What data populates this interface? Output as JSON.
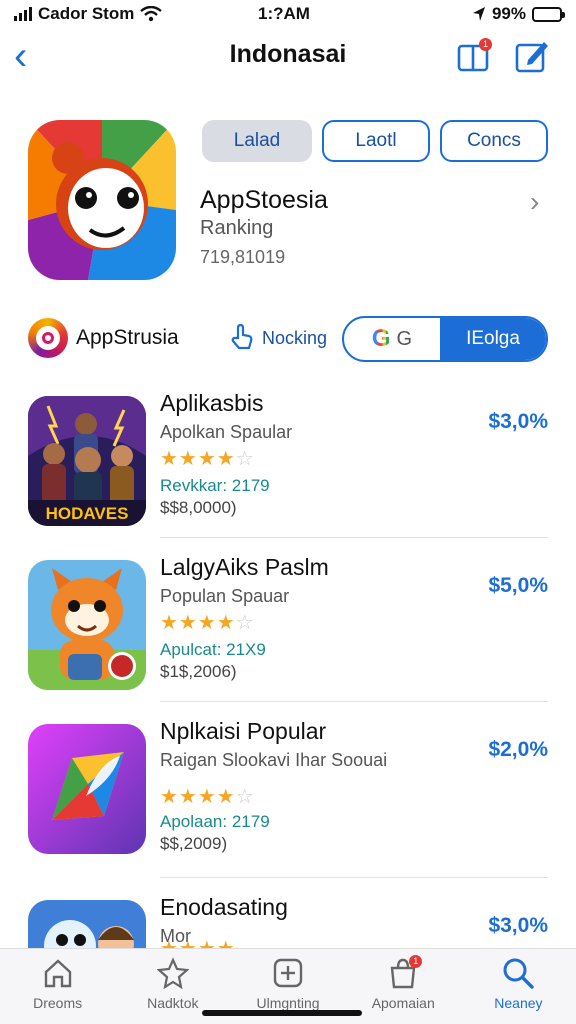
{
  "status": {
    "carrier": "Cador Stom",
    "time": "1:?AM",
    "battery": "99%"
  },
  "nav": {
    "title": "Indonasai",
    "share_badge": "1"
  },
  "header": {
    "segments": [
      {
        "label": "Lalad",
        "active": true
      },
      {
        "label": "Laotl",
        "active": false
      },
      {
        "label": "Concs",
        "active": false
      }
    ],
    "app_name": "AppStoesia",
    "app_subtitle": "Ranking",
    "app_number": "719,81019"
  },
  "filter": {
    "brand_label": "AppStrusia",
    "nocking_label": "Nocking",
    "toggle_left": "G",
    "toggle_right": "IEolga"
  },
  "apps": [
    {
      "name": "Aplikasbis",
      "subtitle": "Apolkan Spaular",
      "rating": 4,
      "meta": "Revkkar: 2179",
      "price": "$$8,0000)",
      "pct": "$3,0%",
      "thumb_text": "HODAVES"
    },
    {
      "name": "LalgyAiks Paslm",
      "subtitle": "Populan Spauar",
      "rating": 4,
      "meta": "Apulcat: 21X9",
      "price": "$1$,2006)",
      "pct": "$5,0%"
    },
    {
      "name": "Nplkaisi Popular",
      "subtitle": "Raigan Slookavi Ihar Soouai",
      "rating": 4,
      "meta": "Apolaan: 2179",
      "price": "$$,2009)",
      "pct": "$2,0%"
    },
    {
      "name": "Enodasating",
      "subtitle": "Mor",
      "rating": 4,
      "meta": "",
      "price": "",
      "pct": "$3,0%"
    }
  ],
  "tabs": [
    {
      "label": "Dreoms",
      "icon": "home-icon",
      "active": false
    },
    {
      "label": "Nadktok",
      "icon": "star-icon",
      "active": false
    },
    {
      "label": "Ulmgnting",
      "icon": "plus-square-icon",
      "active": false
    },
    {
      "label": "Apomaian",
      "icon": "bag-icon",
      "active": false,
      "badge": "1"
    },
    {
      "label": "Neaney",
      "icon": "search-icon",
      "active": true
    }
  ],
  "colors": {
    "accent": "#1c6ed6",
    "star": "#f5a623",
    "meta": "#1a8a8a"
  }
}
